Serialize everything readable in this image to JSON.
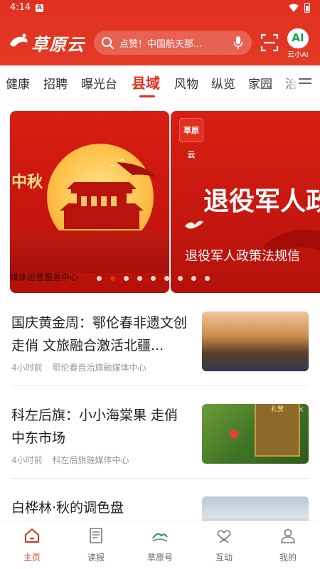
{
  "status_bar": {
    "time": "4:14",
    "notification_icon": "a-icon"
  },
  "header": {
    "logo_text": "草原云",
    "search_placeholder": "点赞！中国航天那...",
    "ai_badge": "AI",
    "ai_label": "云小AI"
  },
  "tabs": [
    {
      "label": "健康"
    },
    {
      "label": "招聘"
    },
    {
      "label": "曝光台"
    },
    {
      "label": "县域",
      "active": true
    },
    {
      "label": "风物"
    },
    {
      "label": "纵览"
    },
    {
      "label": "家园"
    },
    {
      "label": "治"
    }
  ],
  "banner": {
    "slides": [
      {
        "overlay_text": "中秋",
        "caption": "媒体运营服务中心"
      },
      {
        "logo_text": "草原云",
        "headline": "退役军人政",
        "subtitle": "退役军人政策法规信"
      }
    ],
    "dot_count": 9,
    "active_dot": 1
  },
  "news": [
    {
      "title": "国庆黄金周：鄂伦春非遗文创走俏 文旅融合激活北疆...",
      "time": "4小时前",
      "source": "鄂伦春自治旗融媒体中心"
    },
    {
      "title": "科左后旗：小小海棠果 走俏中东市场",
      "time": "4小时前",
      "source": "科左后旗融媒体中心",
      "ad_text": "大美敖汉 生态礼赞",
      "close_glyph": "✕"
    },
    {
      "title": "白桦林·秋的调色盘"
    }
  ],
  "bottom_nav": [
    {
      "label": "主页",
      "icon": "home-icon",
      "active": true
    },
    {
      "label": "读报",
      "icon": "newspaper-icon"
    },
    {
      "label": "草原号",
      "icon": "grassland-icon"
    },
    {
      "label": "互动",
      "icon": "heart-hands-icon"
    },
    {
      "label": "我的",
      "icon": "person-icon"
    }
  ],
  "colors": {
    "brand_red": "#e1301f",
    "text": "#222222",
    "meta": "#999999"
  }
}
